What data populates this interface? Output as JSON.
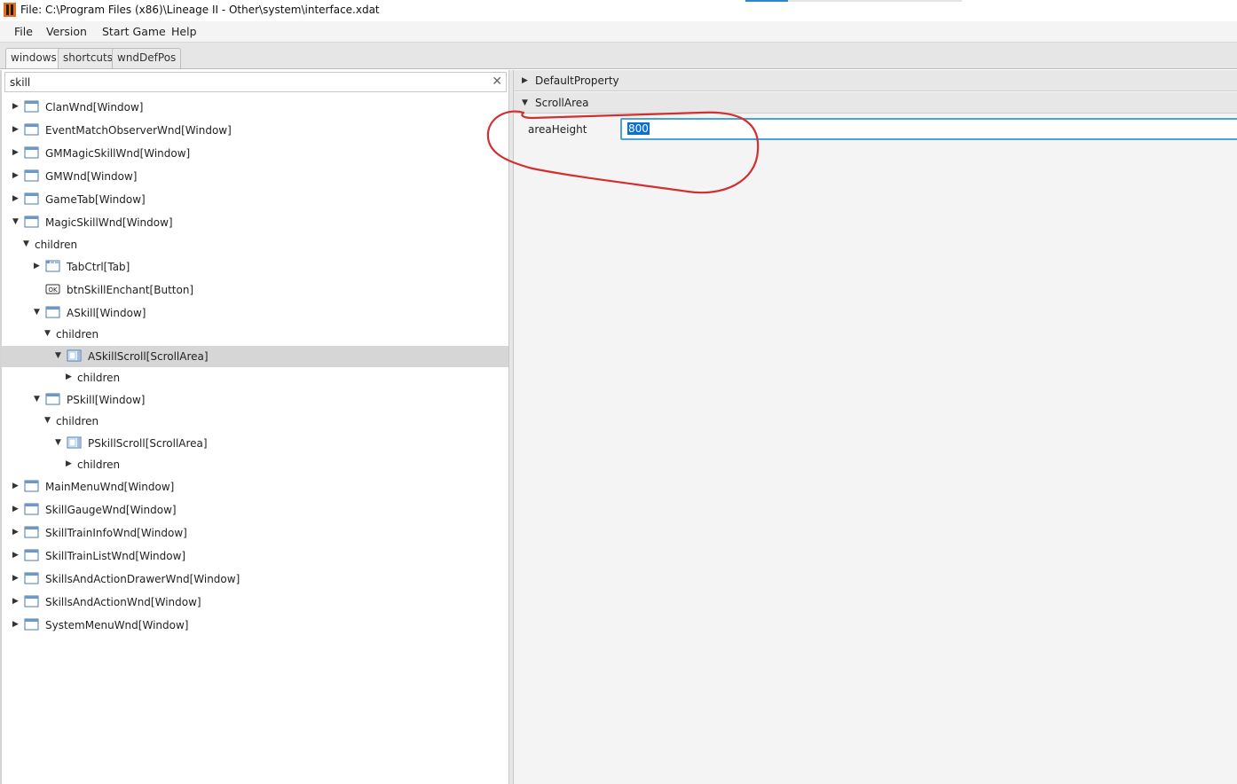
{
  "window": {
    "title": "File: C:\\Program Files (x86)\\Lineage II - Other\\system\\interface.xdat",
    "icon": "app-icon"
  },
  "menu": [
    "File",
    "Version",
    "Start Game",
    "Help"
  ],
  "tabs": [
    {
      "label": "windows",
      "active": true
    },
    {
      "label": "shortcuts",
      "active": false
    },
    {
      "label": "wndDefPos",
      "active": false
    }
  ],
  "search": {
    "value": "skill",
    "clear_glyph": "✕"
  },
  "tree": [
    {
      "label": "ClanWnd[Window]",
      "depth": 0,
      "expander": "collapsed",
      "icon": "window-icon"
    },
    {
      "label": "EventMatchObserverWnd[Window]",
      "depth": 0,
      "expander": "collapsed",
      "icon": "window-icon"
    },
    {
      "label": "GMMagicSkillWnd[Window]",
      "depth": 0,
      "expander": "collapsed",
      "icon": "window-icon"
    },
    {
      "label": "GMWnd[Window]",
      "depth": 0,
      "expander": "collapsed",
      "icon": "window-icon"
    },
    {
      "label": "GameTab[Window]",
      "depth": 0,
      "expander": "collapsed",
      "icon": "window-icon"
    },
    {
      "label": "MagicSkillWnd[Window]",
      "depth": 0,
      "expander": "expanded",
      "icon": "window-icon"
    },
    {
      "label": "children",
      "depth": 1,
      "expander": "expanded",
      "icon": "none"
    },
    {
      "label": "TabCtrl[Tab]",
      "depth": 2,
      "expander": "collapsed",
      "icon": "tab-icon"
    },
    {
      "label": "btnSkillEnchant[Button]",
      "depth": 2,
      "expander": "none",
      "icon": "button-icon"
    },
    {
      "label": "ASkill[Window]",
      "depth": 2,
      "expander": "expanded",
      "icon": "window-icon"
    },
    {
      "label": "children",
      "depth": 3,
      "expander": "expanded",
      "icon": "none"
    },
    {
      "label": "ASkillScroll[ScrollArea]",
      "depth": 4,
      "expander": "expanded",
      "icon": "scrollarea-icon",
      "selected": true
    },
    {
      "label": "children",
      "depth": 5,
      "expander": "collapsed",
      "icon": "none"
    },
    {
      "label": "PSkill[Window]",
      "depth": 2,
      "expander": "expanded",
      "icon": "window-icon"
    },
    {
      "label": "children",
      "depth": 3,
      "expander": "expanded",
      "icon": "none"
    },
    {
      "label": "PSkillScroll[ScrollArea]",
      "depth": 4,
      "expander": "expanded",
      "icon": "scrollarea-icon"
    },
    {
      "label": "children",
      "depth": 5,
      "expander": "collapsed",
      "icon": "none"
    },
    {
      "label": "MainMenuWnd[Window]",
      "depth": 0,
      "expander": "collapsed",
      "icon": "window-icon"
    },
    {
      "label": "SkillGaugeWnd[Window]",
      "depth": 0,
      "expander": "collapsed",
      "icon": "window-icon"
    },
    {
      "label": "SkillTrainInfoWnd[Window]",
      "depth": 0,
      "expander": "collapsed",
      "icon": "window-icon"
    },
    {
      "label": "SkillTrainListWnd[Window]",
      "depth": 0,
      "expander": "collapsed",
      "icon": "window-icon"
    },
    {
      "label": "SkillsAndActionDrawerWnd[Window]",
      "depth": 0,
      "expander": "collapsed",
      "icon": "window-icon"
    },
    {
      "label": "SkillsAndActionWnd[Window]",
      "depth": 0,
      "expander": "collapsed",
      "icon": "window-icon"
    },
    {
      "label": "SystemMenuWnd[Window]",
      "depth": 0,
      "expander": "collapsed",
      "icon": "window-icon"
    }
  ],
  "properties": {
    "sections": [
      {
        "label": "DefaultProperty",
        "expander": "collapsed"
      },
      {
        "label": "ScrollArea",
        "expander": "expanded"
      }
    ],
    "area_height": {
      "label": "areaHeight",
      "value": "800"
    }
  },
  "colors": {
    "accent": "#48a3db",
    "selection": "#d6d6d6",
    "annotation": "#d32f2f"
  }
}
